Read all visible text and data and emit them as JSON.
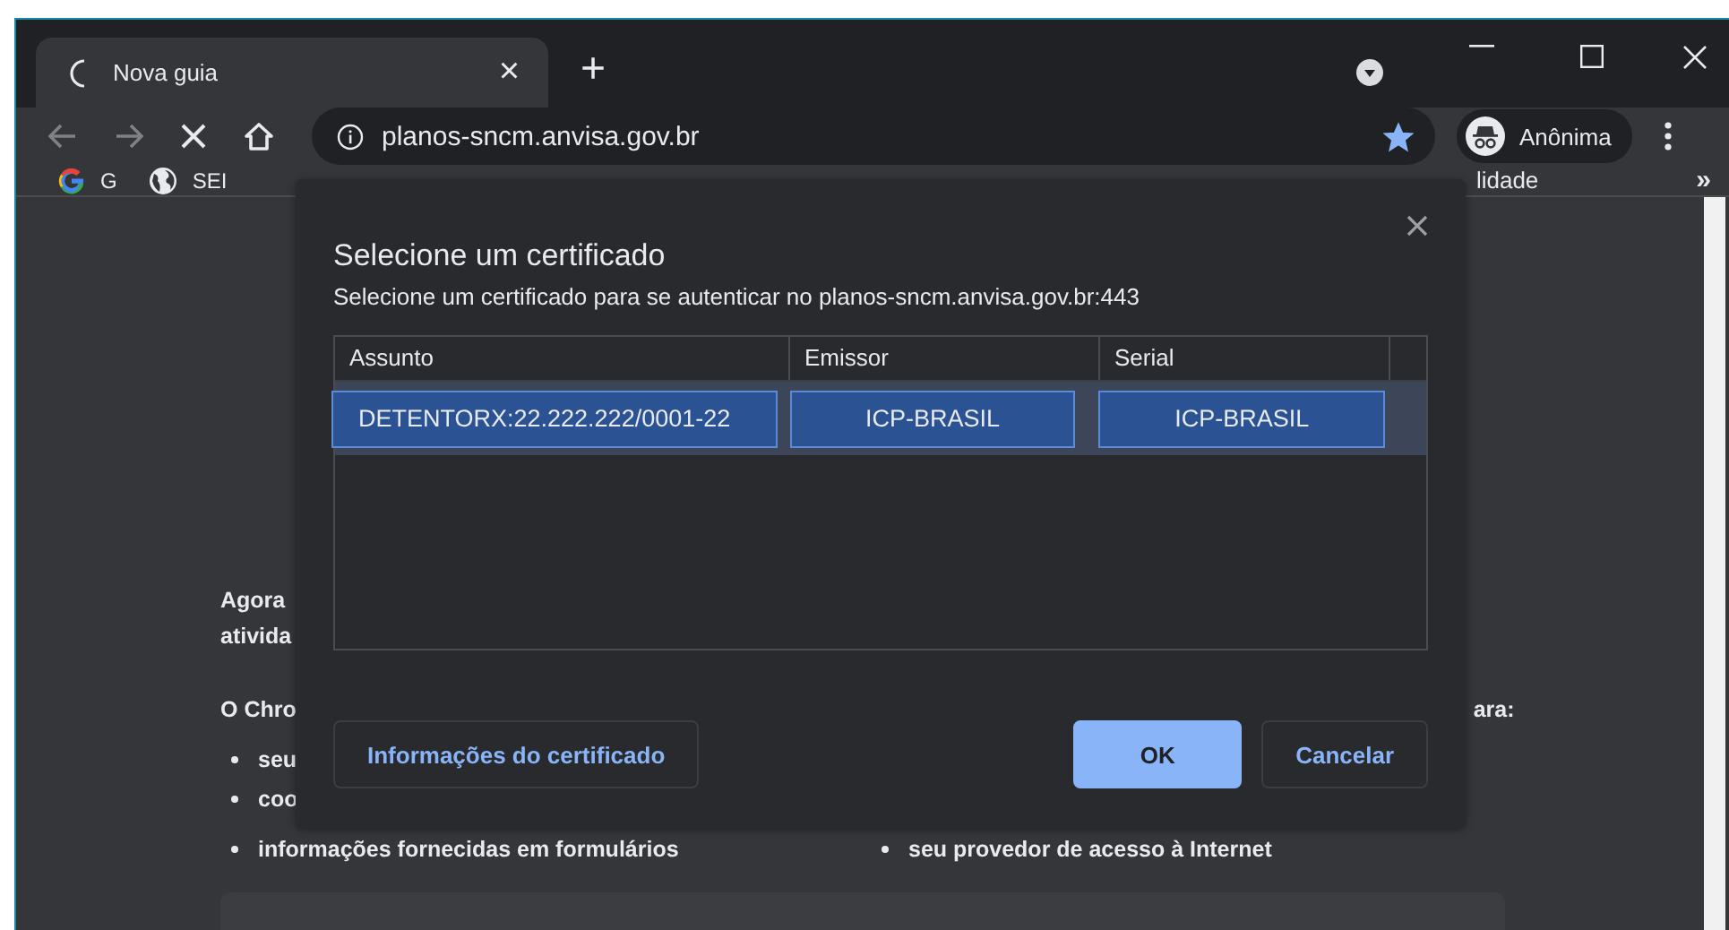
{
  "tab": {
    "title": "Nova guia",
    "close": "×",
    "new_tab": "+"
  },
  "address": {
    "url": "planos-sncm.anvisa.gov.br",
    "starred": true
  },
  "profile": {
    "label": "Anônima"
  },
  "bookmarks": [
    {
      "label": "G",
      "kind": "google"
    },
    {
      "label": "SEI",
      "kind": "globe"
    }
  ],
  "bookmarks_cut": "lidade",
  "bookmarks_more": "»",
  "page": {
    "left_lines": [
      "Agora",
      "ativida"
    ],
    "lead": "O Chro",
    "lead_right": "ara:",
    "bullets": [
      "seu",
      "coo",
      "informações fornecidas em formulários"
    ],
    "bullet_right": "seu provedor de acesso à Internet"
  },
  "dialog": {
    "title": "Selecione um certificado",
    "subtitle": "Selecione um certificado para se autenticar no planos-sncm.anvisa.gov.br:443",
    "columns": [
      "Assunto",
      "Emissor",
      "Serial"
    ],
    "rows": [
      {
        "cells": [
          "DETENTORX:22.222.222/0001-22",
          "ICP-BRASIL",
          "ICP-BRASIL"
        ],
        "selected": true
      }
    ],
    "buttons": [
      {
        "label": "Informações do certificado",
        "kind": "secondary"
      },
      {
        "label": "OK",
        "kind": "primary"
      },
      {
        "label": "Cancelar",
        "kind": "secondary"
      }
    ]
  }
}
